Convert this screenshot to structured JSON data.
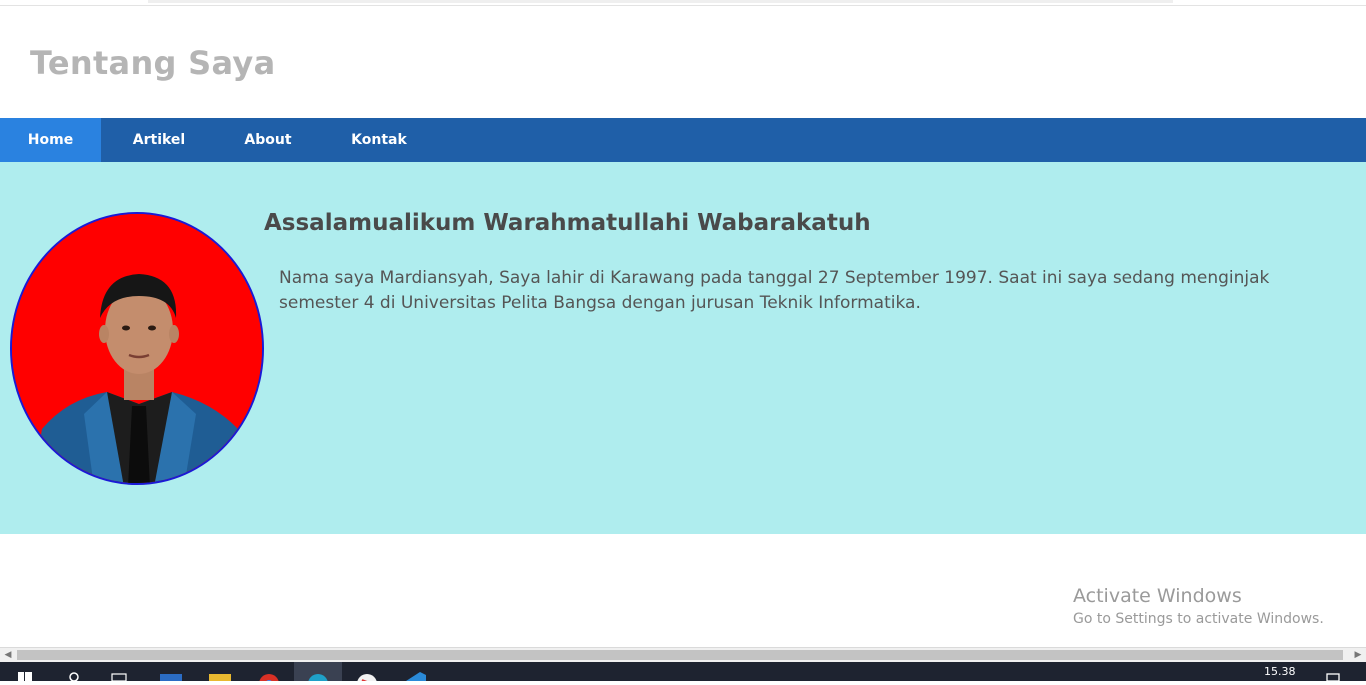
{
  "header": {
    "title": "Tentang Saya"
  },
  "nav": {
    "items": [
      {
        "label": "Home",
        "active": true
      },
      {
        "label": "Artikel",
        "active": false
      },
      {
        "label": "About",
        "active": false
      },
      {
        "label": "Kontak",
        "active": false
      }
    ]
  },
  "profile": {
    "heading": "Assalamualikum Warahmatullahi Wabarakatuh",
    "bio": "Nama saya Mardiansyah, Saya lahir di Karawang pada tanggal 27 September 1997. Saat ini saya sedang menginjak semester 4 di Universitas Pelita Bangsa dengan jurusan Teknik Informatika."
  },
  "watermark": {
    "line1": "Activate Windows",
    "line2": "Go to Settings to activate Windows."
  },
  "taskbar": {
    "clock": "15.38"
  },
  "colors": {
    "nav": "#1f5fa8",
    "nav_active": "#2a82e0",
    "hero_bg": "#afedee",
    "avatar_bg": "#ff0000",
    "avatar_border": "#1a1ad6"
  }
}
